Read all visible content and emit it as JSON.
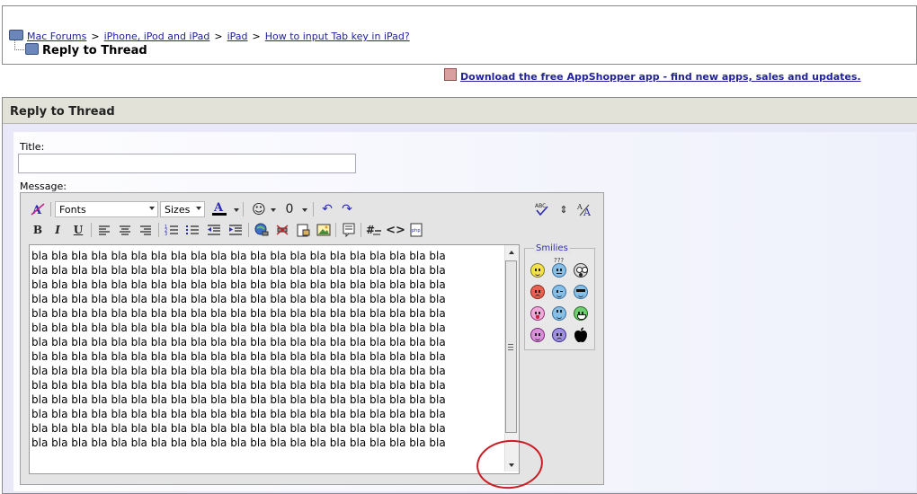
{
  "breadcrumb": {
    "items": [
      "Mac Forums",
      "iPhone, iPod and iPad",
      "iPad",
      "How to input Tab key in iPad?"
    ],
    "separator": ">",
    "current": "Reply to Thread"
  },
  "promo": {
    "text": "Download the free AppShopper app - find new apps, sales and updates."
  },
  "panel": {
    "title": "Reply to Thread",
    "title_label": "Title:",
    "title_value": "",
    "message_label": "Message:"
  },
  "toolbar": {
    "font_select": "Fonts",
    "size_select": "Sizes",
    "bold": "B",
    "italic": "I",
    "underline": "U"
  },
  "message": {
    "line": "bla bla bla bla bla bla bla bla bla bla bla bla bla bla bla bla bla bla bla bla bla",
    "line_count": 14
  },
  "smilies": {
    "title": "Smilies",
    "icons": [
      "smile-icon",
      "confused-icon",
      "eek-icon",
      "mad-icon",
      "wink-icon",
      "cool-icon",
      "tongue-icon",
      "rolleyes-icon",
      "grin-icon",
      "biggrin-icon",
      "frown-icon",
      "apple-icon"
    ],
    "confused_label": "???"
  },
  "colors": {
    "link": "#22229c",
    "panel_bg": "#e8e8f8",
    "annotation": "#cc1c24"
  }
}
